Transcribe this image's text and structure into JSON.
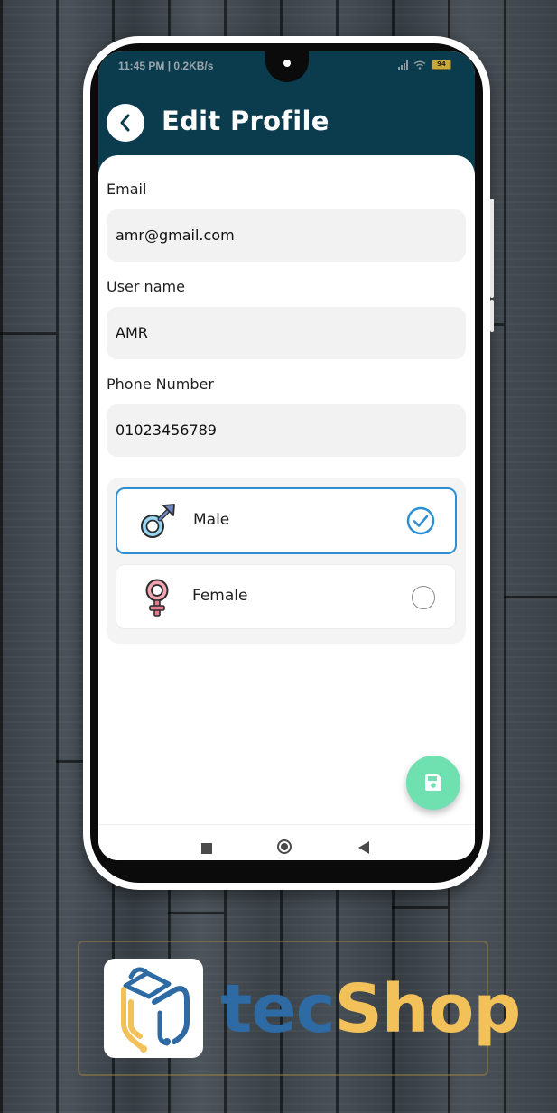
{
  "status_bar": {
    "time": "11:45 PM | 0.2KB/s",
    "battery": "94"
  },
  "header": {
    "title": "Edit Profile",
    "back_icon": "chevron-left-icon"
  },
  "form": {
    "email": {
      "label": "Email",
      "value": "amr@gmail.com"
    },
    "username": {
      "label": "User name",
      "value": "AMR"
    },
    "phone": {
      "label": "Phone Number",
      "value": "01023456789"
    }
  },
  "gender": {
    "options": [
      {
        "label": "Male",
        "icon": "male-symbol-icon",
        "selected": true
      },
      {
        "label": "Female",
        "icon": "female-symbol-icon",
        "selected": false
      }
    ]
  },
  "fab": {
    "icon": "save-icon",
    "color": "#6fe0b0"
  },
  "brand": {
    "part1": "tec",
    "part2": "Shop",
    "part1_color": "#2e6aa3",
    "part2_color": "#f3c15a"
  },
  "colors": {
    "appbar": "#0b3c4d",
    "accent": "#2c8fd6"
  }
}
